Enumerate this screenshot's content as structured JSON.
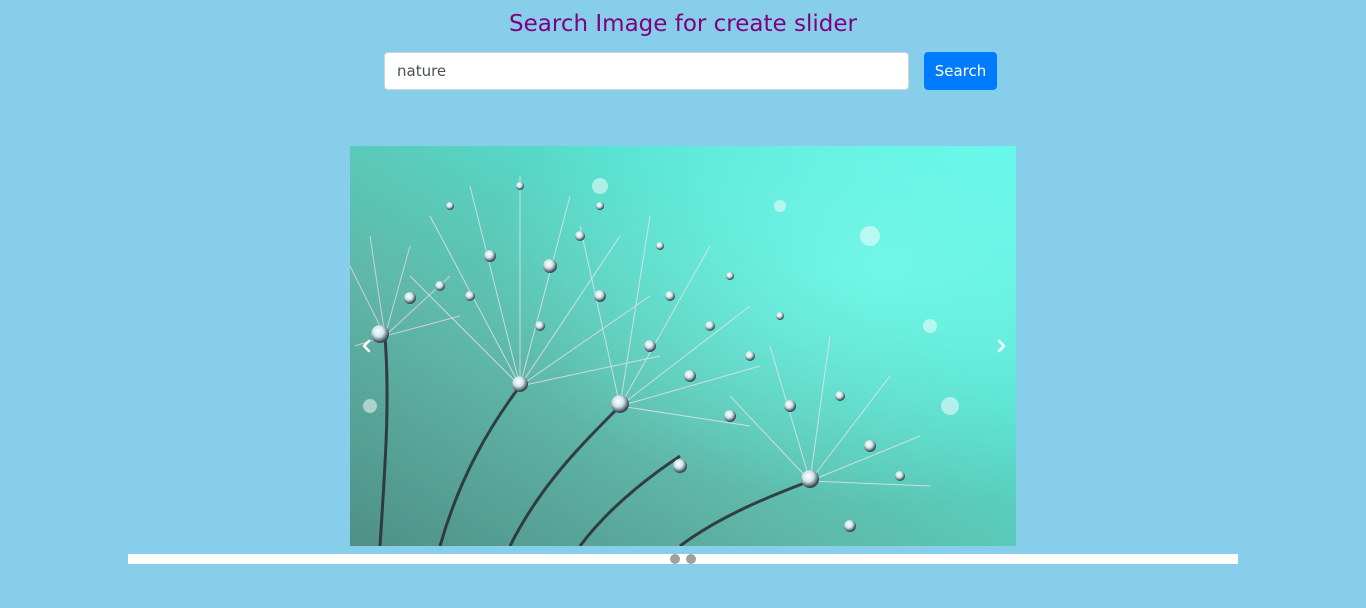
{
  "header": {
    "title": "Search Image for create slider"
  },
  "search": {
    "value": "nature",
    "button_label": "Search"
  },
  "slider": {
    "slide_count": 2,
    "active_slide": 1,
    "slides": [
      {
        "subject": "dandelion seeds with water droplets on teal background"
      }
    ],
    "prev_icon": "chevron-left-icon",
    "next_icon": "chevron-right-icon"
  },
  "colors": {
    "background": "#87ceeb",
    "title": "#800080",
    "button": "#007bff",
    "dots_bar": "#ffffff",
    "dot": "#a0a0a0"
  }
}
